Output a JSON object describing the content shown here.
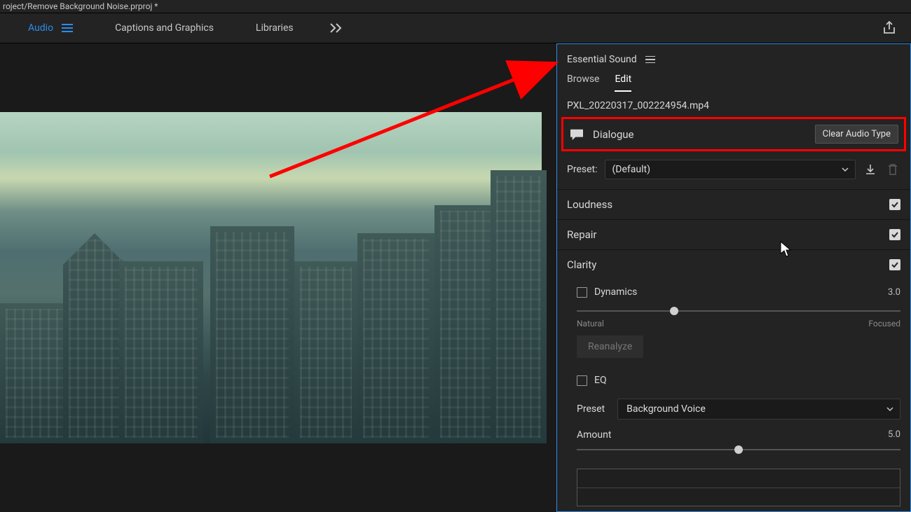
{
  "titlebar": {
    "project_path": "roject/Remove Background Noise.prproj *"
  },
  "workspaces": {
    "audio": "Audio",
    "captions": "Captions and Graphics",
    "libraries": "Libraries"
  },
  "panel": {
    "title": "Essential Sound",
    "tabs": {
      "browse": "Browse",
      "edit": "Edit"
    },
    "clip_name": "PXL_20220317_002224954.mp4",
    "audio_type": {
      "label": "Dialogue",
      "clear": "Clear Audio Type"
    },
    "preset": {
      "label": "Preset:",
      "value": "(Default)"
    },
    "sections": {
      "loudness": "Loudness",
      "repair": "Repair",
      "clarity": "Clarity"
    },
    "dynamics": {
      "label": "Dynamics",
      "value": "3.0",
      "left": "Natural",
      "right": "Focused",
      "reanalyze": "Reanalyze"
    },
    "eq": {
      "label": "EQ",
      "preset_label": "Preset",
      "preset_value": "Background Voice",
      "amount_label": "Amount",
      "amount_value": "5.0"
    }
  },
  "colors": {
    "accent": "#2d8ceb",
    "annotation": "#ff0000"
  }
}
